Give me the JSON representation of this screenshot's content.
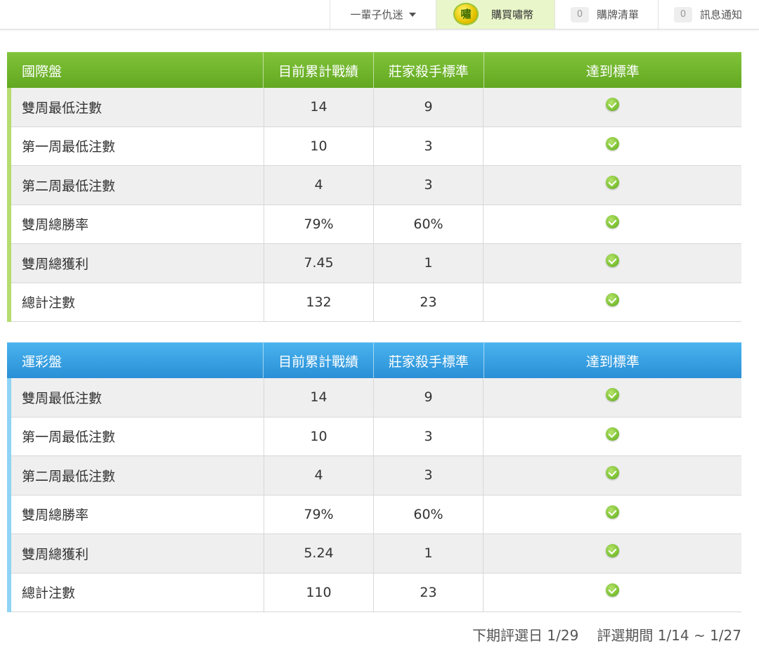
{
  "topbar": {
    "user": "一輩子仇迷",
    "buy": {
      "coin_glyph": "嘯",
      "label": "購買嘯幣"
    },
    "cart": {
      "count": "0",
      "label": "購牌清單"
    },
    "messages": {
      "count": "0",
      "label": "訊息通知"
    }
  },
  "tables": {
    "intl": {
      "headers": [
        "國際盤",
        "目前累計戰績",
        "莊家殺手標準",
        "達到標準"
      ],
      "rows": [
        [
          "雙周最低注數",
          "14",
          "9"
        ],
        [
          "第一周最低注數",
          "10",
          "3"
        ],
        [
          "第二周最低注數",
          "4",
          "3"
        ],
        [
          "雙周總勝率",
          "79%",
          "60%"
        ],
        [
          "雙周總獲利",
          "7.45",
          "1"
        ],
        [
          "總計注數",
          "132",
          "23"
        ]
      ]
    },
    "sport": {
      "headers": [
        "運彩盤",
        "目前累計戰績",
        "莊家殺手標準",
        "達到標準"
      ],
      "rows": [
        [
          "雙周最低注數",
          "14",
          "9"
        ],
        [
          "第一周最低注數",
          "10",
          "3"
        ],
        [
          "第二周最低注數",
          "4",
          "3"
        ],
        [
          "雙周總勝率",
          "79%",
          "60%"
        ],
        [
          "雙周總獲利",
          "5.24",
          "1"
        ],
        [
          "總計注數",
          "110",
          "23"
        ]
      ]
    }
  },
  "footer": {
    "next_date": "下期評選日 1/29",
    "period": "評選期間 1/14 ~ 1/27"
  }
}
